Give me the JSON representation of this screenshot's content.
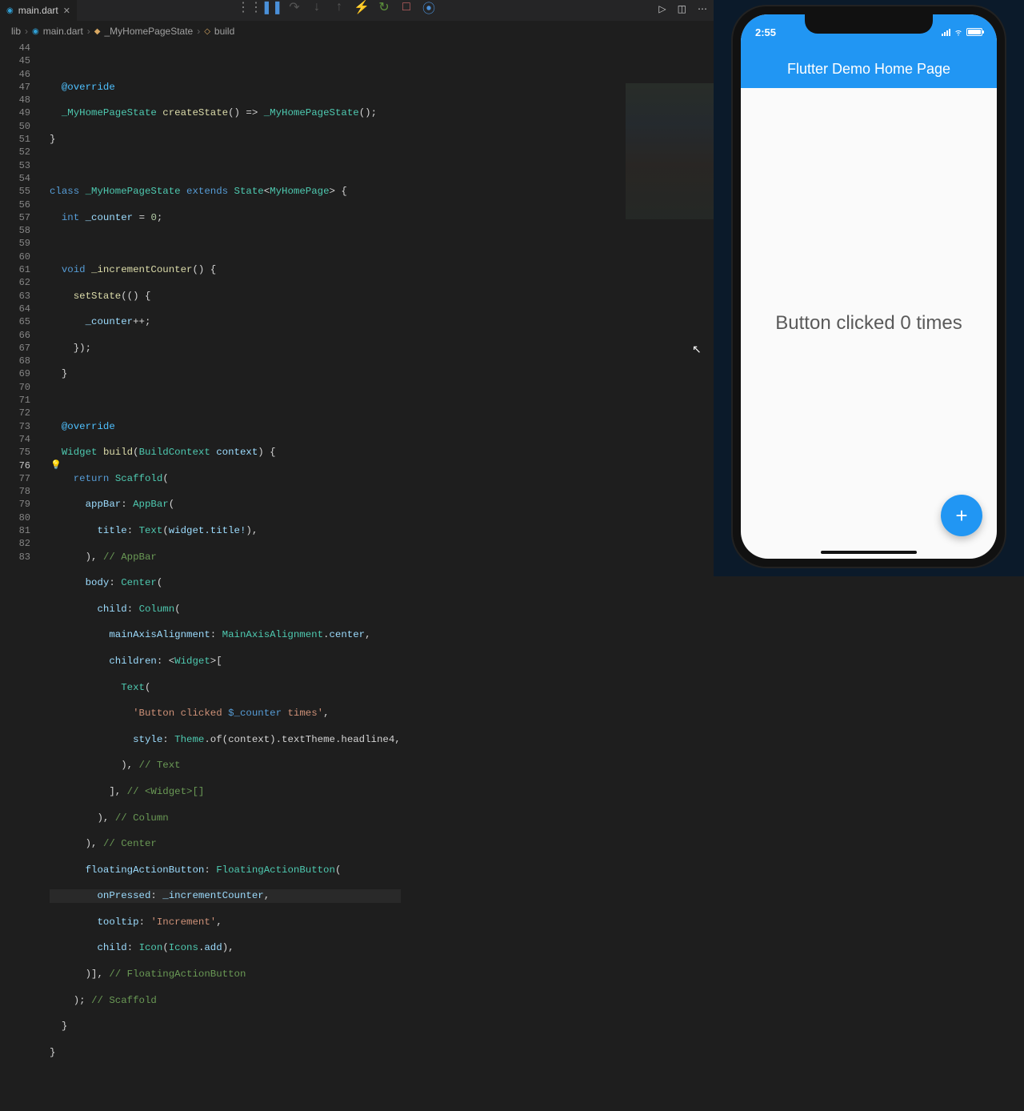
{
  "tab": {
    "filename": "main.dart"
  },
  "breadcrumb": {
    "folder": "lib",
    "file": "main.dart",
    "class": "_MyHomePageState",
    "method": "build"
  },
  "gutter": {
    "start": 44,
    "end": 83,
    "highlighted": 76
  },
  "device": {
    "time": "2:55",
    "app_title": "Flutter Demo Home Page",
    "body_text": "Button clicked 0 times"
  },
  "code": {
    "l45": "@override",
    "l46_a": "_MyHomePageState",
    "l46_b": "createState",
    "l46_c": "_MyHomePageState",
    "l49_class": "class",
    "l49_name": "_MyHomePageState",
    "l49_ext": "extends",
    "l49_state": "State",
    "l49_gen": "MyHomePage",
    "l50_type": "int",
    "l50_var": "_counter",
    "l50_val": "0",
    "l52_void": "void",
    "l52_fn": "_incrementCounter",
    "l53_fn": "setState",
    "l54_var": "_counter",
    "l58": "@override",
    "l59_type": "Widget",
    "l59_fn": "build",
    "l59_param_t": "BuildContext",
    "l59_param_n": "context",
    "l60_ret": "return",
    "l60_cls": "Scaffold",
    "l61_prop": "appBar",
    "l61_cls": "AppBar",
    "l62_prop": "title",
    "l62_cls": "Text",
    "l62_expr": "widget.title!",
    "l63_cmt": "// AppBar",
    "l64_prop": "body",
    "l64_cls": "Center",
    "l65_prop": "child",
    "l65_cls": "Column",
    "l66_prop": "mainAxisAlignment",
    "l66_cls": "MainAxisAlignment",
    "l66_val": "center",
    "l67_prop": "children",
    "l67_cls": "Widget",
    "l68_cls": "Text",
    "l69_s1": "'Button clicked ",
    "l69_interp": "$_counter",
    "l69_s2": " times'",
    "l70_prop": "style",
    "l70_cls": "Theme",
    "l70_rest": ".of(context).textTheme.headline4,",
    "l71_cmt": "// Text",
    "l72_cmt": "// <Widget>[]",
    "l73_cmt": "// Column",
    "l74_cmt": "// Center",
    "l75_prop": "floatingActionButton",
    "l75_cls": "FloatingActionButton",
    "l76_prop": "onPressed",
    "l76_val": "_incrementCounter",
    "l77_prop": "tooltip",
    "l77_val": "'Increment'",
    "l78_prop": "child",
    "l78_cls": "Icon",
    "l78_icons": "Icons",
    "l78_val": "add",
    "l79_cmt": "// FloatingActionButton",
    "l80_cmt": "// Scaffold"
  }
}
